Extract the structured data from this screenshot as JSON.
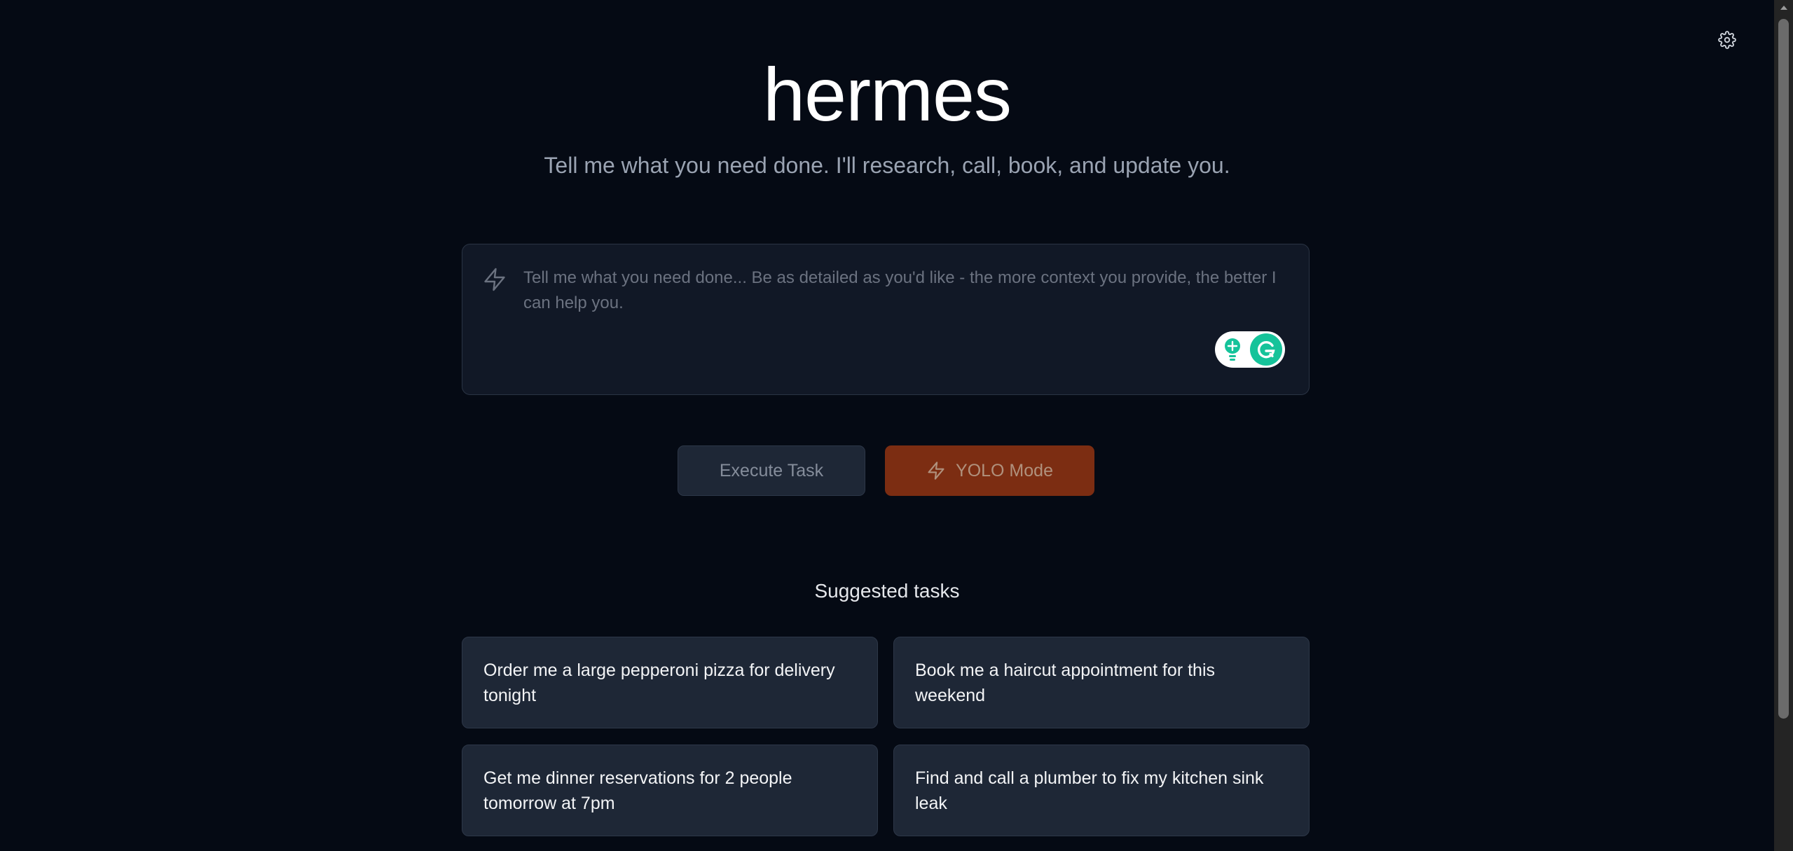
{
  "header": {
    "title": "hermes",
    "subtitle": "Tell me what you need done. I'll research, call, book, and update you.",
    "settings_icon": "gear-icon"
  },
  "task_input": {
    "placeholder": "Tell me what you need done... Be as detailed as you'd like - the more context you provide, the better I can help you.",
    "value": "",
    "icon": "lightning-icon"
  },
  "actions": {
    "execute_label": "Execute Task",
    "yolo_label": "YOLO Mode"
  },
  "suggested": {
    "heading": "Suggested tasks",
    "tasks": [
      "Order me a large pepperoni pizza for delivery tonight",
      "Book me a haircut appointment for this weekend",
      "Get me dinner reservations for 2 people tomorrow at 7pm",
      "Find and call a plumber to fix my kitchen sink leak"
    ]
  },
  "colors": {
    "background": "#050a14",
    "card": "#1e2736",
    "yolo": "#7c2d12",
    "grammarly": "#15c39a"
  }
}
